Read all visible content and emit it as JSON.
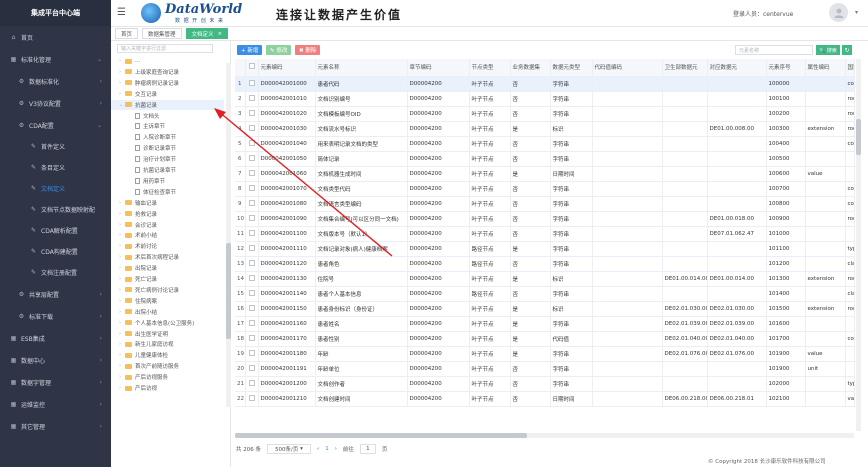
{
  "sidebar": {
    "brand": "集成平台中心端",
    "items": [
      {
        "label": "首页",
        "icon": "home-icon",
        "level": 0
      },
      {
        "label": "标准化管理",
        "icon": "grid-icon",
        "level": 0,
        "chev": "⌄"
      },
      {
        "label": "数据标准化",
        "icon": "gear-icon",
        "level": 1,
        "chev": "›"
      },
      {
        "label": "V3协议配置",
        "icon": "gear-icon",
        "level": 1,
        "chev": "›"
      },
      {
        "label": "CDA配置",
        "icon": "gear-icon",
        "level": 1,
        "chev": "⌄"
      },
      {
        "label": "首件定义",
        "icon": "tool-icon",
        "level": 2
      },
      {
        "label": "条目定义",
        "icon": "tool-icon",
        "level": 2
      },
      {
        "label": "文档定义",
        "icon": "tool-icon",
        "level": 2,
        "active": true
      },
      {
        "label": "文档节点数据映射配",
        "icon": "tool-icon",
        "level": 2
      },
      {
        "label": "CDA解析配置",
        "icon": "tool-icon",
        "level": 2
      },
      {
        "label": "CDA构建配置",
        "icon": "tool-icon",
        "level": 2
      },
      {
        "label": "文档注册配置",
        "icon": "tool-icon",
        "level": 2
      },
      {
        "label": "共享层配置",
        "icon": "gear-icon",
        "level": 1,
        "chev": "›"
      },
      {
        "label": "标准下载",
        "icon": "gear-icon",
        "level": 1,
        "chev": "›"
      },
      {
        "label": "ESB集成",
        "icon": "grid-icon",
        "level": 0,
        "chev": "›"
      },
      {
        "label": "数据中心",
        "icon": "grid-icon",
        "level": 0,
        "chev": "›"
      },
      {
        "label": "数据字管理",
        "icon": "grid-icon",
        "level": 0,
        "chev": "›"
      },
      {
        "label": "运维监控",
        "icon": "grid-icon",
        "level": 0,
        "chev": "›"
      },
      {
        "label": "其它管理",
        "icon": "grid-icon",
        "level": 0,
        "chev": "›"
      }
    ]
  },
  "header": {
    "logo_text": "DataWorld",
    "logo_sub": "数 据 开 创 未 来",
    "slogan": "连接让数据产生价值",
    "login_label": "登录人员：centervue",
    "caret": "▾"
  },
  "tabs": [
    {
      "label": "首页",
      "active": false
    },
    {
      "label": "数据集管理",
      "active": false
    },
    {
      "label": "文档定义",
      "active": true
    }
  ],
  "tree": {
    "search_placeholder": "输入关键字进行过滤",
    "nodes": [
      {
        "label": "...",
        "type": "folder",
        "indent": 1,
        "arrow": "›"
      },
      {
        "label": "上级家庭查询记录",
        "type": "folder",
        "indent": 1,
        "arrow": "›"
      },
      {
        "label": "肿瘤病例记录记录",
        "type": "folder",
        "indent": 1,
        "arrow": "›"
      },
      {
        "label": "交互记录",
        "type": "folder",
        "indent": 1,
        "arrow": "›"
      },
      {
        "label": "抗菌记录",
        "type": "folder",
        "indent": 1,
        "arrow": "⌄",
        "highlight": true
      },
      {
        "label": "文档头",
        "type": "file",
        "indent": 2,
        "arrow": ""
      },
      {
        "label": "主诉章节",
        "type": "file",
        "indent": 2,
        "arrow": ""
      },
      {
        "label": "入院诊断章节",
        "type": "file",
        "indent": 2,
        "arrow": ""
      },
      {
        "label": "诊断记录章节",
        "type": "file",
        "indent": 2,
        "arrow": ""
      },
      {
        "label": "治疗计划章节",
        "type": "file",
        "indent": 2,
        "arrow": ""
      },
      {
        "label": "抗菌记录章节",
        "type": "file",
        "indent": 2,
        "arrow": ""
      },
      {
        "label": "用药章节",
        "type": "file",
        "indent": 2,
        "arrow": ""
      },
      {
        "label": "体征检查章节",
        "type": "file",
        "indent": 2,
        "arrow": ""
      },
      {
        "label": "输血记录",
        "type": "folder",
        "indent": 1,
        "arrow": "›"
      },
      {
        "label": "抢救记录",
        "type": "folder",
        "indent": 1,
        "arrow": "›"
      },
      {
        "label": "会诊记录",
        "type": "folder",
        "indent": 1,
        "arrow": "›"
      },
      {
        "label": "术前小结",
        "type": "folder",
        "indent": 1,
        "arrow": "›"
      },
      {
        "label": "术前讨论",
        "type": "folder",
        "indent": 1,
        "arrow": "›"
      },
      {
        "label": "术后首次病程记录",
        "type": "folder",
        "indent": 1,
        "arrow": "›"
      },
      {
        "label": "出院记录",
        "type": "folder",
        "indent": 1,
        "arrow": "›"
      },
      {
        "label": "死亡记录",
        "type": "folder",
        "indent": 1,
        "arrow": "›"
      },
      {
        "label": "死亡病例讨论记录",
        "type": "folder",
        "indent": 1,
        "arrow": "›"
      },
      {
        "label": "住院病案",
        "type": "folder",
        "indent": 1,
        "arrow": "›"
      },
      {
        "label": "出院小结",
        "type": "folder",
        "indent": 1,
        "arrow": "›"
      },
      {
        "label": "个人基本信息(公卫服务)",
        "type": "folder",
        "indent": 1,
        "arrow": "›"
      },
      {
        "label": "出生医学证明",
        "type": "folder",
        "indent": 1,
        "arrow": "›"
      },
      {
        "label": "新生儿家庭访视",
        "type": "folder",
        "indent": 1,
        "arrow": "›"
      },
      {
        "label": "儿童健康体检",
        "type": "folder",
        "indent": 1,
        "arrow": "›"
      },
      {
        "label": "首次产前随访服务",
        "type": "folder",
        "indent": 1,
        "arrow": "›"
      },
      {
        "label": "产后访视服务",
        "type": "folder",
        "indent": 1,
        "arrow": "›"
      },
      {
        "label": "产后访视",
        "type": "folder",
        "indent": 1,
        "arrow": "›"
      }
    ]
  },
  "toolbar": {
    "add_label": "+ 新增",
    "edit_label": "✎ 修改",
    "delete_label": "✖ 删除",
    "search_placeholder": "元素名称",
    "search_button": "🔍 搜索",
    "refresh_icon": "↻"
  },
  "table": {
    "columns": [
      "",
      "",
      "元素编码",
      "元素名称",
      "章节编码",
      "节点类型",
      "业务数据集",
      "数据元类型",
      "代码值编码",
      "卫生部数据元",
      "对应数据元",
      "元素序号",
      "属性编码",
      "国家属性"
    ],
    "rows": [
      [
        "1",
        "D000042001000",
        "患者代码",
        "D00004200",
        "叶子节点",
        "否",
        "字符串",
        "",
        "",
        "",
        "100000",
        "",
        "code"
      ],
      [
        "2",
        "D000042001010",
        "文档识别编号",
        "D00004200",
        "叶子节点",
        "否",
        "字符串",
        "",
        "",
        "",
        "100100",
        "",
        "root"
      ],
      [
        "3",
        "D000042001020",
        "文档模板编号OID",
        "D00004200",
        "叶子节点",
        "否",
        "字符串",
        "",
        "",
        "",
        "100200",
        "",
        "root"
      ],
      [
        "4",
        "D000042001030",
        "文档流水号标识",
        "D00004200",
        "叶子节点",
        "是",
        "标识",
        "",
        "",
        "DE01.00.008.00",
        "100300",
        "extension",
        "root"
      ],
      [
        "5",
        "D000042001040",
        "用来表明记录文档的类型",
        "D00004200",
        "叶子节点",
        "否",
        "字符串",
        "",
        "",
        "",
        "100400",
        "",
        "code"
      ],
      [
        "6",
        "D000042001050",
        "简体记录",
        "D00004200",
        "叶子节点",
        "否",
        "字符串",
        "",
        "",
        "",
        "100500",
        "",
        ""
      ],
      [
        "7",
        "D000042001060",
        "文档机器生成时间",
        "D00004200",
        "叶子节点",
        "是",
        "日期时间",
        "",
        "",
        "",
        "100600",
        "value",
        ""
      ],
      [
        "8",
        "D000042001070",
        "文档类型代码",
        "D00004200",
        "叶子节点",
        "否",
        "字符串",
        "",
        "",
        "",
        "100700",
        "",
        "code"
      ],
      [
        "9",
        "D000042001080",
        "文档语言类型编码",
        "D00004200",
        "叶子节点",
        "否",
        "字符串",
        "",
        "",
        "",
        "100800",
        "",
        "code"
      ],
      [
        "10",
        "D000042001090",
        "文档集合编号(可以区分同一文档)",
        "D00004200",
        "叶子节点",
        "否",
        "字符串",
        "",
        "",
        "DE01.00.018.00",
        "100900",
        "",
        "root"
      ],
      [
        "11",
        "D000042001100",
        "文档版本号（默认1）",
        "D00004200",
        "叶子节点",
        "否",
        "字符串",
        "",
        "",
        "DE07.01.062.47",
        "101000",
        "",
        ""
      ],
      [
        "12",
        "D000042001110",
        "文档记录对象(病人)健康档案",
        "D00004200",
        "路径节点",
        "是",
        "字符串",
        "",
        "",
        "",
        "101100",
        "",
        "type"
      ],
      [
        "13",
        "D000042001120",
        "患者角色",
        "D00004200",
        "路径节点",
        "否",
        "字符串",
        "",
        "",
        "",
        "101200",
        "",
        "class"
      ],
      [
        "14",
        "D000042001130",
        "住院号",
        "D00004200",
        "叶子节点",
        "是",
        "标识",
        "",
        "DE01.00.014.00",
        "DE01.00.014.00",
        "101300",
        "extension",
        "root"
      ],
      [
        "15",
        "D000042001140",
        "患者个人基本信息",
        "D00004200",
        "路径节点",
        "否",
        "字符串",
        "",
        "",
        "",
        "101400",
        "",
        "class"
      ],
      [
        "16",
        "D000042001150",
        "患者身份标识（身份证）",
        "D00004200",
        "叶子节点",
        "是",
        "标识",
        "",
        "DE02.01.030.00",
        "DE02.01.030.00",
        "101500",
        "extension",
        "root"
      ],
      [
        "17",
        "D000042001160",
        "患者姓名",
        "D00004200",
        "叶子节点",
        "是",
        "字符串",
        "",
        "DE02.01.039.00",
        "DE02.01.039.00",
        "101600",
        "",
        ""
      ],
      [
        "18",
        "D000042001170",
        "患者性别",
        "D00004200",
        "叶子节点",
        "是",
        "代码值",
        "",
        "DE02.01.040.00",
        "DE02.01.040.00",
        "101700",
        "",
        "code"
      ],
      [
        "19",
        "D000042001180",
        "年龄",
        "D00004200",
        "叶子节点",
        "是",
        "字符串",
        "",
        "DE02.01.076.00",
        "DE02.01.076.00",
        "101900",
        "value",
        ""
      ],
      [
        "20",
        "D000042001191",
        "年龄单位",
        "D00004200",
        "叶子节点",
        "否",
        "字符串",
        "",
        "",
        "",
        "101900",
        "unit",
        ""
      ],
      [
        "21",
        "D000042001200",
        "文档创作者",
        "D00004200",
        "叶子节点",
        "否",
        "字符串",
        "",
        "",
        "",
        "102000",
        "",
        "type"
      ],
      [
        "22",
        "D000042001210",
        "文档创建时间",
        "D00004200",
        "叶子节点",
        "否",
        "日期时间",
        "",
        "DE06.00.218.00",
        "DE06.00.218.01",
        "102100",
        "",
        "value"
      ]
    ]
  },
  "pager": {
    "total": "共 206 条",
    "page_size": "500条/页",
    "page_size_caret": "▾",
    "prev": "‹",
    "current": "1",
    "next": "›",
    "goto_label": "前往",
    "goto_value": "1",
    "page_suffix": "页"
  },
  "footer": {
    "copyright": "© Copyright 2018 长沙康乐软件科技有限公司"
  },
  "colors": {
    "sidebar_bg": "#2f3447",
    "accent_blue": "#3a8ee6",
    "accent_green": "#42b983",
    "annotation_red": "#e02020"
  }
}
